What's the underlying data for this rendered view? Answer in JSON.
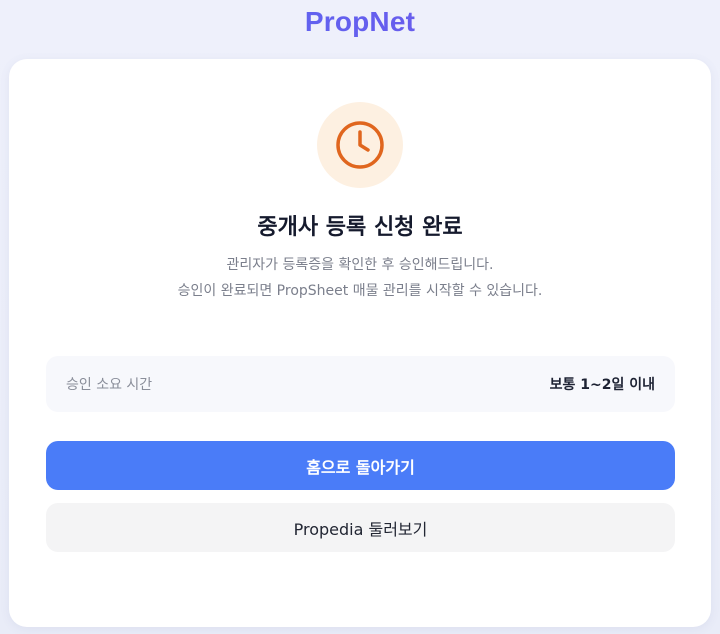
{
  "brand": {
    "name": "PropNet"
  },
  "card": {
    "icon": "clock-icon",
    "title": "중개사 등록 신청 완료",
    "description_line1": "관리자가 등록증을 확인한 후 승인해드립니다.",
    "description_line2": "승인이 완료되면 PropSheet 매물 관리를 시작할 수 있습니다.",
    "info": {
      "label": "승인 소요 시간",
      "value": "보통 1~2일 이내"
    },
    "primary_button": "홈으로 돌아가기",
    "secondary_button": "Propedia 둘러보기"
  },
  "colors": {
    "primary": "#4a7cf8",
    "icon_orange": "#e0661e",
    "icon_bg": "#fdf0e1"
  }
}
